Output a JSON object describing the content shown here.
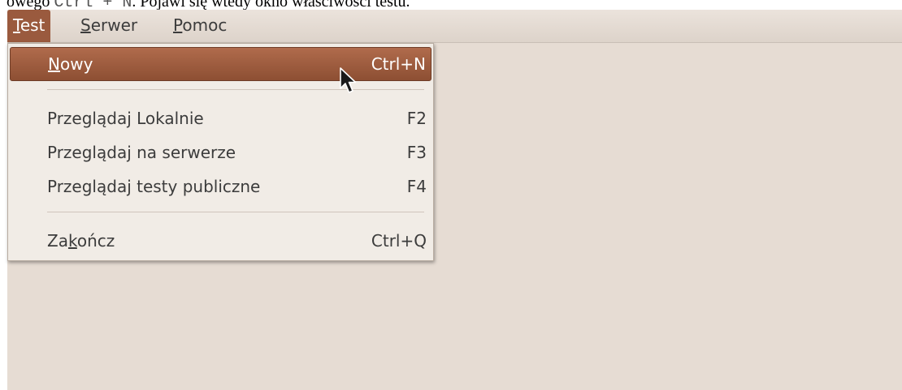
{
  "caption": {
    "text_before": "owego ",
    "code": "Ctrl + N",
    "text_after": ". Pojawi się wtedy okno właściwości testu."
  },
  "menubar": {
    "items": [
      {
        "label": "Test",
        "accel": "T",
        "rest": "est",
        "open": true
      },
      {
        "label": "Serwer",
        "accel": "S",
        "rest": "erwer"
      },
      {
        "label": "Pomoc",
        "accel": "P",
        "rest": "omoc"
      }
    ]
  },
  "test_menu": {
    "new": {
      "accel": "N",
      "rest": "owy",
      "shortcut": "Ctrl+N"
    },
    "browse_local": {
      "label": "Przeglądaj Lokalnie",
      "shortcut": "F2"
    },
    "browse_server": {
      "label": "Przeglądaj na serwerze",
      "shortcut": "F3"
    },
    "browse_public": {
      "label": "Przeglądaj testy publiczne",
      "shortcut": "F4"
    },
    "quit": {
      "pre": "Za",
      "accel": "k",
      "rest": "ończ",
      "shortcut": "Ctrl+Q"
    }
  },
  "colors": {
    "highlight": "#9a5a3e",
    "window_bg": "#e6dcd3",
    "menu_bg": "#f1ece6"
  },
  "icons": {
    "cursor": "mouse-pointer-icon"
  }
}
